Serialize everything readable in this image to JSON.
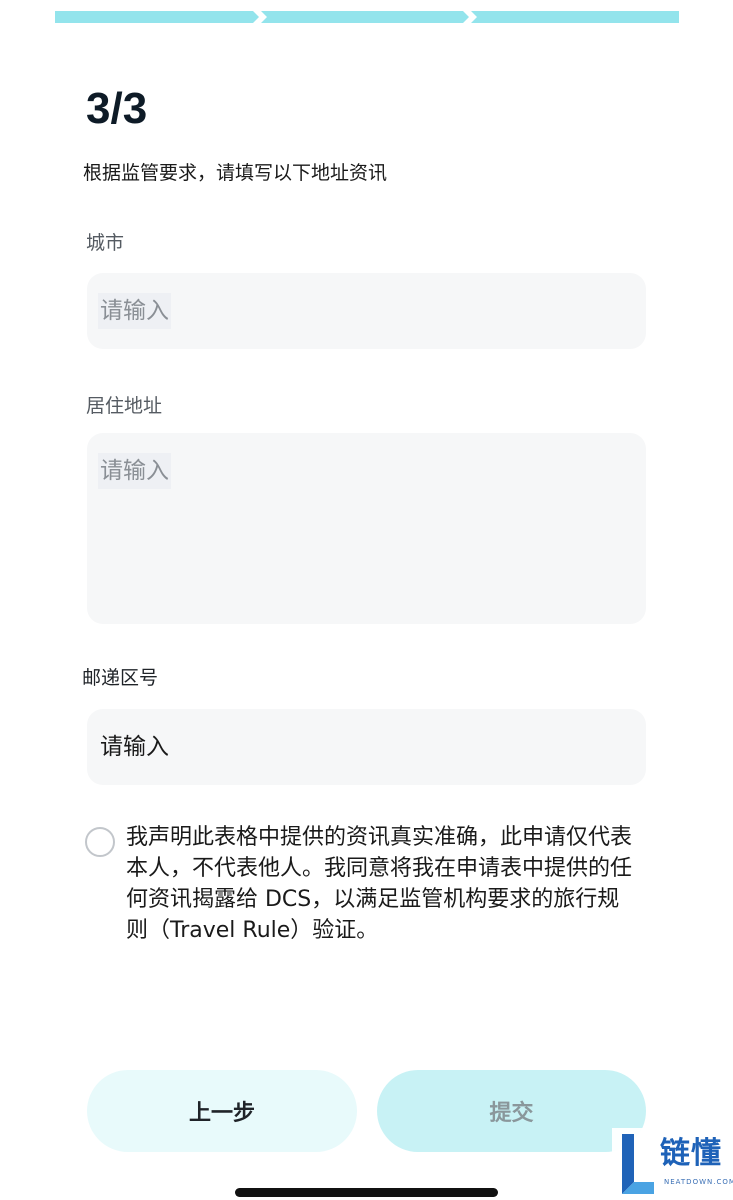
{
  "step_counter": "3/3",
  "instruction": "根据监管要求，请填写以下地址资讯",
  "fields": [
    {
      "label": "城市",
      "placeholder": "请输入"
    },
    {
      "label": "居住地址",
      "placeholder": "请输入"
    },
    {
      "label": "邮递区号",
      "placeholder": "请输入"
    }
  ],
  "consent_text": "我声明此表格中提供的资讯真实准确，此申请仅代表本人，不代表他人。我同意将我在申请表中提供的任何资讯揭露给 DCS，以满足监管机构要求的旅行规则（Travel Rule）验证。",
  "buttons": {
    "prev": "上一步",
    "submit": "提交"
  },
  "watermark": {
    "title": "链懂",
    "subtitle": "NEATDOWN.COM"
  },
  "colors": {
    "progress": "#93e4ec",
    "prev_button_bg": "#e8fafb",
    "submit_button_bg": "#c8f2f5",
    "input_bg": "#f6f7f8"
  }
}
